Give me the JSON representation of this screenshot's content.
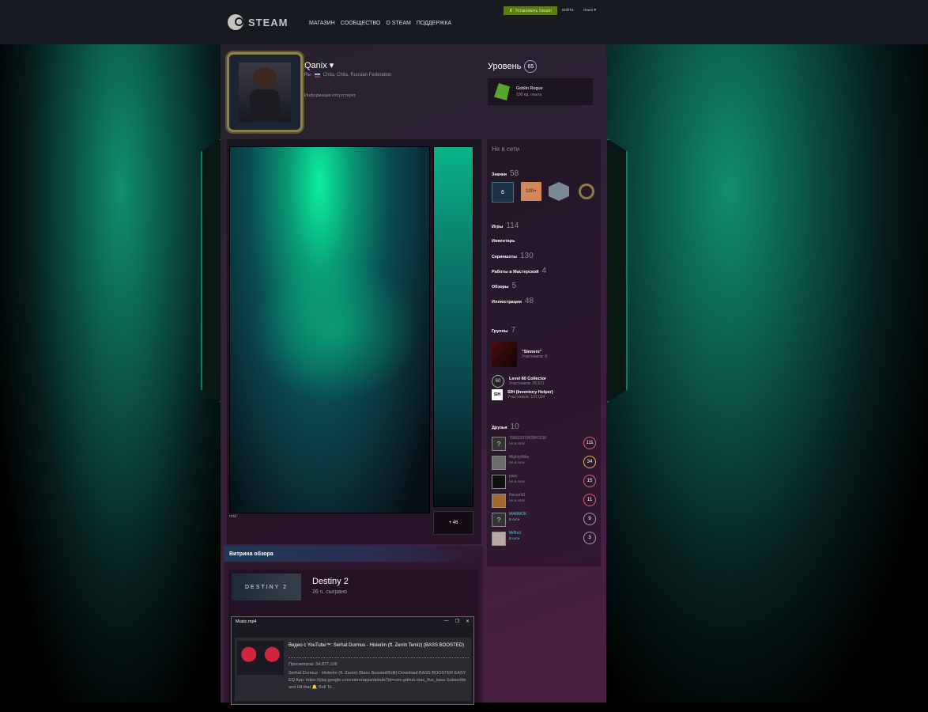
{
  "topbar": {
    "logo_text": "STEAM",
    "nav": [
      "МАГАЗИН",
      "СООБЩЕСТВО",
      "О STEAM",
      "ПОДДЕРЖКА"
    ],
    "install_label": "Установить Steam",
    "login_label": "войти",
    "lang_label": "язык ▾"
  },
  "profile": {
    "persona_name": "Qanix ▾",
    "real_name": "Rы",
    "location": "Chita, Chita, Russian Federation",
    "summary": "Информация отсутствует.",
    "level_label": "Уровень",
    "level": "65",
    "favorite_badge": {
      "name": "Goblin Rogue",
      "xp": "100 ед. опыта"
    }
  },
  "artwork": {
    "title": "mtd",
    "more_label": "+ 46"
  },
  "review": {
    "header": "Витрина обзора",
    "game_logo": "DESTINY 2",
    "game_name": "Destiny 2",
    "hours": "26 ч. сыграно",
    "video": {
      "window_title": "Music.mp4",
      "controls": [
        "—",
        "❐",
        "✕"
      ],
      "title": "Видео с YouTube™: Serhat Durmus - Hisleri̇m (ft. Zerrin Temiz) (BASS BOOSTED)",
      "views": "Просмотров: 34,877,106",
      "description": "Serhat Durmus - Hisleri̇m (ft. Zerrin) (Bass Boosted/Edit) Download BASS BOOSTER EASY EQ App: https://play.google.com/store/apps/details?id=com.github.max_five_bass Subscribe and Hit that 🔔 Bell To..."
    }
  },
  "sidebar": {
    "status": "Не в сети",
    "badges": {
      "label": "Значки",
      "count": "58",
      "items": [
        "6",
        "100+",
        "",
        ""
      ]
    },
    "counts": [
      {
        "label": "Игры",
        "count": "114"
      },
      {
        "label": "Инвентарь",
        "count": ""
      },
      {
        "label": "Скриншоты",
        "count": "130"
      },
      {
        "label": "Работы в Мастерской",
        "count": "4"
      },
      {
        "label": "Обзоры",
        "count": "5"
      },
      {
        "label": "Иллюстрации",
        "count": "48"
      }
    ],
    "groups": {
      "label": "Группы",
      "count": "7",
      "items": [
        {
          "name": "\"Sinners\"",
          "members": "Участников: 8",
          "icon": ""
        },
        {
          "name": "Level 60 Collector",
          "members": "Участников: 28,521",
          "icon": "60"
        },
        {
          "name": "SIH (Inventory Helper)",
          "members": "Участников: 197,024",
          "icon": "SIH"
        }
      ]
    },
    "friends": {
      "label": "Друзья",
      "count": "10",
      "items": [
        {
          "name": "76561197962847238",
          "status": "Не в сети",
          "level": "111",
          "avatar": "?",
          "online": false
        },
        {
          "name": "MightyMike",
          "status": "Не в сети",
          "level": "34",
          "avatar": "",
          "online": false
        },
        {
          "name": "pazy",
          "status": "Не в сети",
          "level": "15",
          "avatar": "",
          "online": false
        },
        {
          "name": "ReconN1",
          "status": "Не в сети",
          "level": "11",
          "avatar": "",
          "online": false
        },
        {
          "name": "MARMOK",
          "status": "В сети",
          "level": "9",
          "avatar": "?",
          "online": true
        },
        {
          "name": "MrRoX",
          "status": "В сети",
          "level": "3",
          "avatar": "",
          "online": true
        }
      ]
    }
  }
}
